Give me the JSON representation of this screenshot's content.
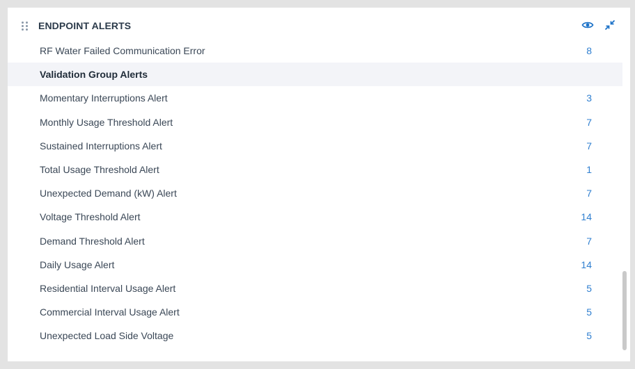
{
  "header": {
    "title": "ENDPOINT ALERTS",
    "icons": {
      "drag": "drag-handle-icon",
      "view": "eye-icon",
      "collapse": "collapse-icon"
    }
  },
  "colors": {
    "accent": "#2f7fd0",
    "group_bg": "#f3f4f8",
    "text": "#3a4756"
  },
  "rows": [
    {
      "label": "RF Water Failed Communication Error",
      "count": "8",
      "group": false
    },
    {
      "label": "Validation Group Alerts",
      "count": "",
      "group": true
    },
    {
      "label": "Momentary Interruptions Alert",
      "count": "3",
      "group": false
    },
    {
      "label": "Monthly Usage Threshold Alert",
      "count": "7",
      "group": false
    },
    {
      "label": "Sustained Interruptions Alert",
      "count": "7",
      "group": false
    },
    {
      "label": "Total Usage Threshold Alert",
      "count": "1",
      "group": false
    },
    {
      "label": "Unexpected Demand (kW) Alert",
      "count": "7",
      "group": false
    },
    {
      "label": "Voltage Threshold Alert",
      "count": "14",
      "group": false
    },
    {
      "label": "Demand Threshold Alert",
      "count": "7",
      "group": false
    },
    {
      "label": "Daily Usage Alert",
      "count": "14",
      "group": false
    },
    {
      "label": "Residential Interval Usage Alert",
      "count": "5",
      "group": false
    },
    {
      "label": "Commercial Interval Usage Alert",
      "count": "5",
      "group": false
    },
    {
      "label": "Unexpected Load Side Voltage",
      "count": "5",
      "group": false
    }
  ]
}
